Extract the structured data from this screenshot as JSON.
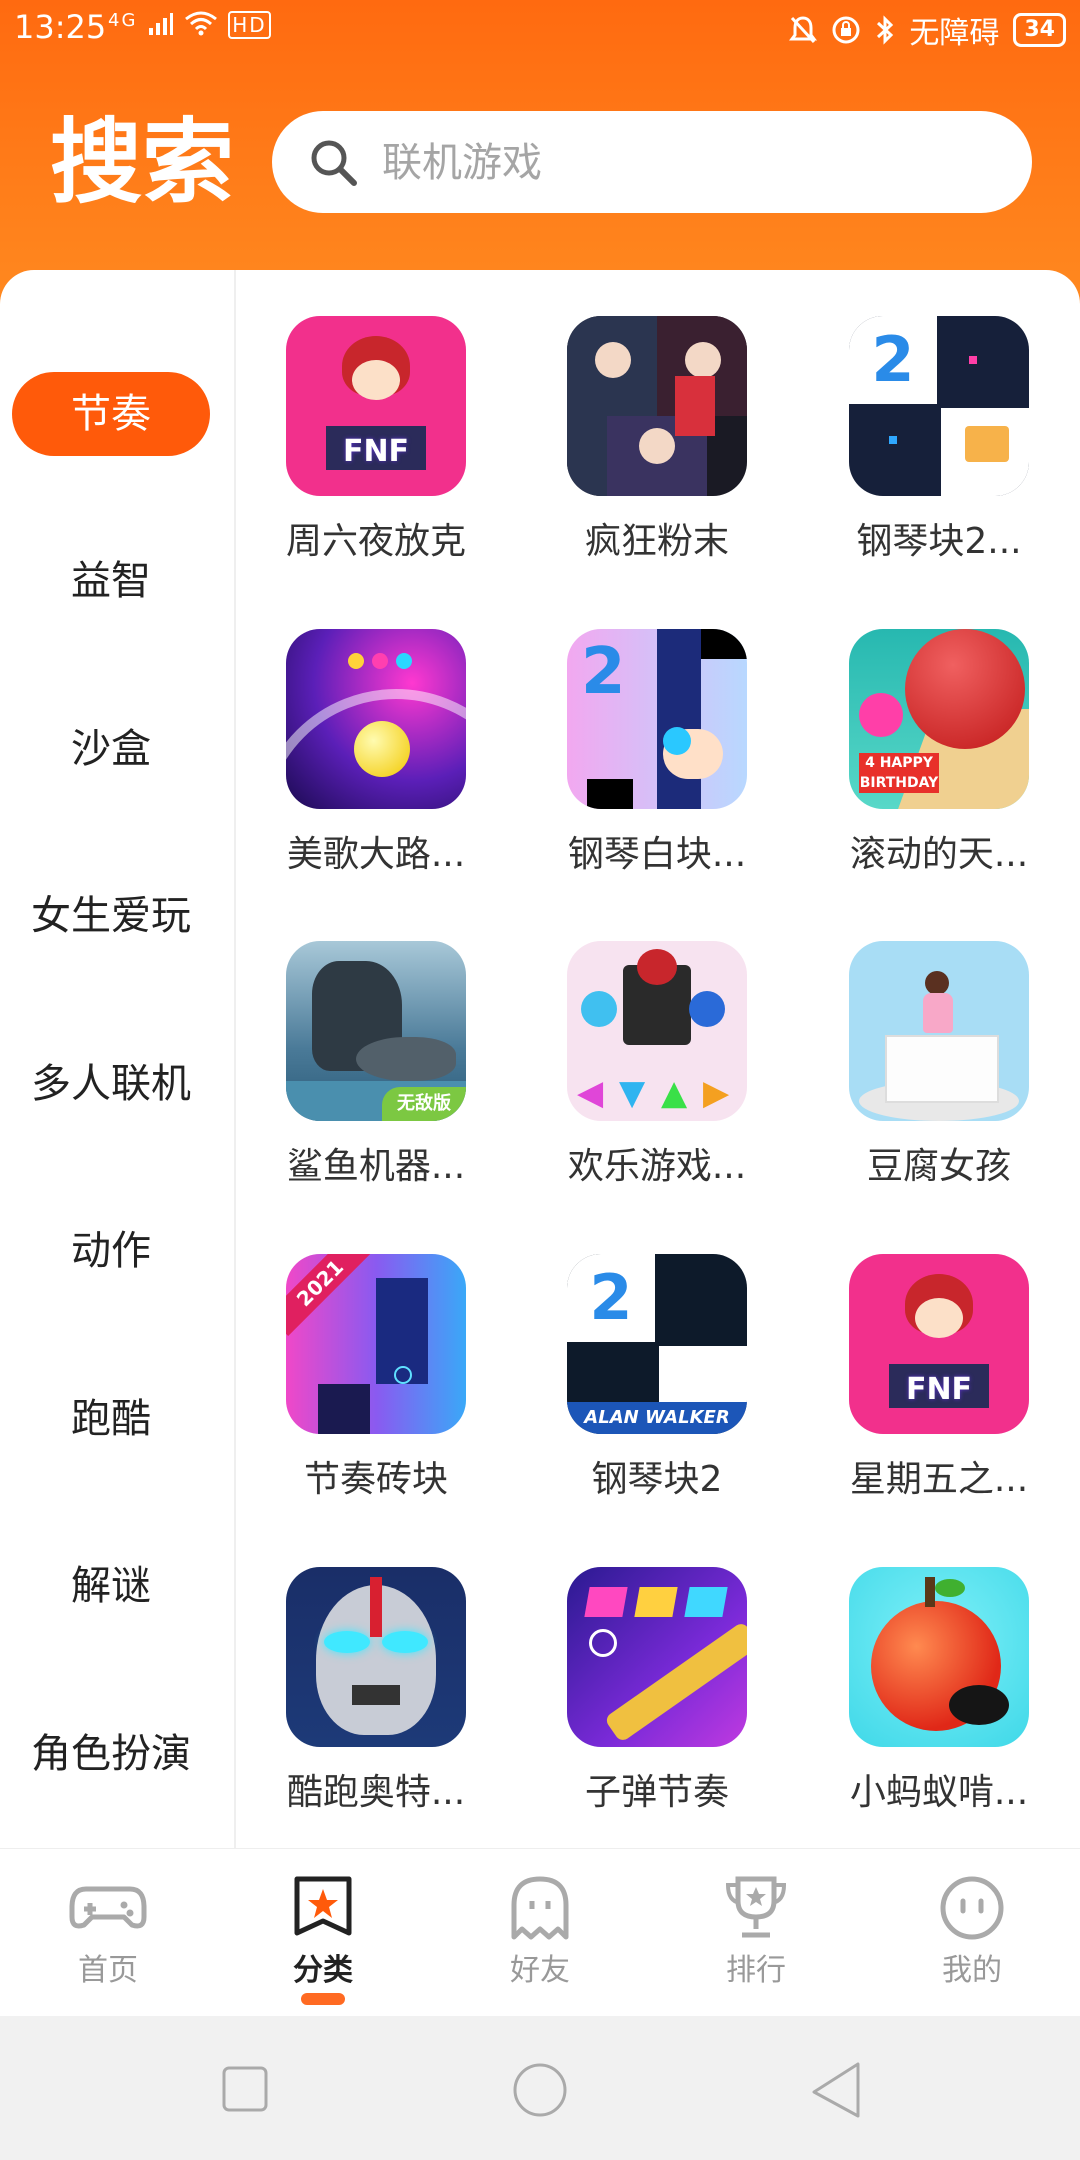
{
  "status_bar": {
    "time": "13:25",
    "signal_text": "4G",
    "hd_badge": "HD",
    "accessibility_text": "无障碍",
    "battery_level": "34"
  },
  "header": {
    "title": "搜索",
    "search_placeholder": "联机游戏"
  },
  "sidebar": {
    "active_index": 0,
    "items": [
      {
        "label": "节奏"
      },
      {
        "label": "益智"
      },
      {
        "label": "沙盒"
      },
      {
        "label": "女生爱玩"
      },
      {
        "label": "多人联机"
      },
      {
        "label": "动作"
      },
      {
        "label": "跑酷"
      },
      {
        "label": "解谜"
      },
      {
        "label": "角色扮演"
      }
    ]
  },
  "games": [
    {
      "name": "周六夜放克",
      "icon": "fnf-girlfriend-icon",
      "color": "#f2308c"
    },
    {
      "name": "疯狂粉末",
      "icon": "anime-trio-icon",
      "color": "#1a1a24"
    },
    {
      "name": "钢琴块2...",
      "icon": "piano-tiles-birthday-icon",
      "color": "#16203a"
    },
    {
      "name": "美歌大路...",
      "icon": "rolling-ball-neon-icon",
      "color": "#5b1fb8"
    },
    {
      "name": "钢琴白块...",
      "icon": "piano-tap-finger-icon",
      "color": "#d9a3f5"
    },
    {
      "name": "滚动的天...",
      "icon": "rolling-sky-birthday-icon",
      "color": "#27b8b0"
    },
    {
      "name": "鲨鱼机器...",
      "icon": "shark-robot-icon",
      "color": "#3b6f8a"
    },
    {
      "name": "欢乐游戏...",
      "icon": "fnf-dance-arrows-icon",
      "color": "#f7e3f0"
    },
    {
      "name": "豆腐女孩",
      "icon": "tofu-girl-icon",
      "color": "#a8ddf5"
    },
    {
      "name": "节奏砖块",
      "icon": "rhythm-tiles-2021-icon",
      "color": "#c33cf0"
    },
    {
      "name": "钢琴块2",
      "icon": "piano-tiles-alan-walker-icon",
      "color": "#0d1a2a"
    },
    {
      "name": "星期五之...",
      "icon": "fnf-friday-icon",
      "color": "#f2308c"
    },
    {
      "name": "酷跑奥特...",
      "icon": "ultraman-icon",
      "color": "#1d3a78"
    },
    {
      "name": "子弹节奏",
      "icon": "bullet-rhythm-gun-icon",
      "color": "#4a2cc0"
    },
    {
      "name": "小蚂蚁啃...",
      "icon": "ant-apple-icon",
      "color": "#3fd8e8"
    }
  ],
  "bottom_nav": {
    "active_index": 1,
    "items": [
      {
        "label": "首页",
        "icon": "gamepad-icon"
      },
      {
        "label": "分类",
        "icon": "category-star-icon"
      },
      {
        "label": "好友",
        "icon": "ghost-friend-icon"
      },
      {
        "label": "排行",
        "icon": "trophy-icon"
      },
      {
        "label": "我的",
        "icon": "smiley-profile-icon"
      }
    ]
  },
  "colors": {
    "accent": "#ff5a0a",
    "header": "#ff7414"
  }
}
